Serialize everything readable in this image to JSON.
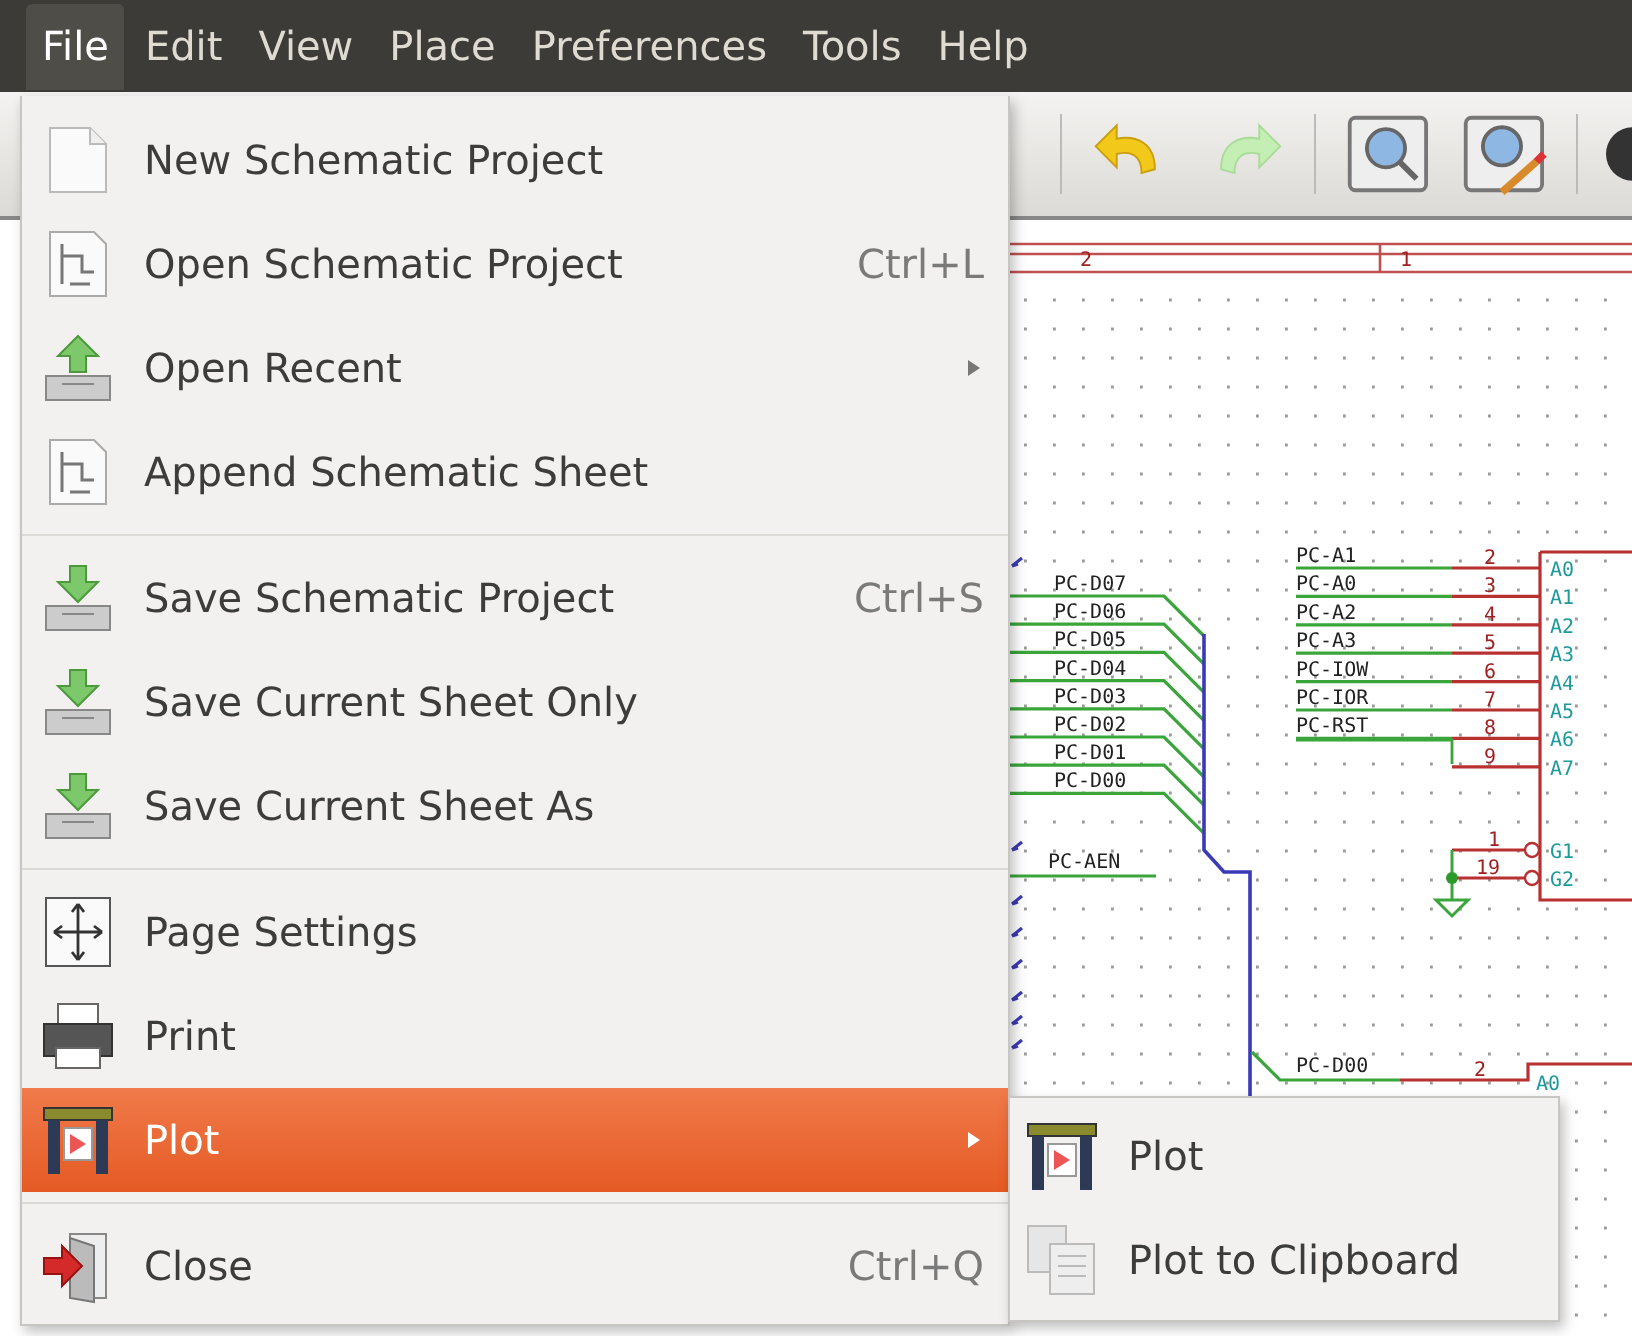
{
  "menubar": [
    {
      "label": "File",
      "selected": true
    },
    {
      "label": "Edit",
      "selected": false
    },
    {
      "label": "View",
      "selected": false
    },
    {
      "label": "Place",
      "selected": false
    },
    {
      "label": "Preferences",
      "selected": false
    },
    {
      "label": "Tools",
      "selected": false
    },
    {
      "label": "Help",
      "selected": false
    }
  ],
  "file_menu": [
    {
      "kind": "item",
      "label": "New Schematic Project",
      "submenu": false,
      "selected": false
    },
    {
      "kind": "item",
      "label": "Open Schematic Project",
      "shortcut": "Ctrl+L",
      "submenu": false,
      "selected": false
    },
    {
      "kind": "item",
      "label": "Open Recent",
      "submenu": true,
      "selected": false
    },
    {
      "kind": "item",
      "label": "Append Schematic Sheet",
      "submenu": false,
      "selected": false
    },
    {
      "kind": "separator"
    },
    {
      "kind": "item",
      "label": "Save Schematic Project",
      "shortcut": "Ctrl+S",
      "submenu": false,
      "selected": false
    },
    {
      "kind": "item",
      "label": "Save Current Sheet Only",
      "submenu": false,
      "selected": false
    },
    {
      "kind": "item",
      "label": "Save Current Sheet As",
      "submenu": false,
      "selected": false
    },
    {
      "kind": "separator"
    },
    {
      "kind": "item",
      "label": "Page Settings",
      "submenu": false,
      "selected": false
    },
    {
      "kind": "item",
      "label": "Print",
      "submenu": false,
      "selected": false
    },
    {
      "kind": "item",
      "label": "Plot",
      "submenu": true,
      "selected": true
    },
    {
      "kind": "separator"
    },
    {
      "kind": "item",
      "label": "Close",
      "shortcut": "Ctrl+Q",
      "submenu": false,
      "selected": false
    }
  ],
  "plot_submenu": [
    {
      "label": "Plot",
      "selected": false
    },
    {
      "label": "Plot to Clipboard",
      "selected": false
    }
  ],
  "schematic": {
    "frame_marks": [
      "2",
      "1"
    ],
    "bus_labels": [
      "PC-D07",
      "PC-D06",
      "PC-D05",
      "PC-D04",
      "PC-D03",
      "PC-D02",
      "PC-D01",
      "PC-D00"
    ],
    "enable_label": "PC-AEN",
    "ic_pins": [
      {
        "net": "PC-A1",
        "number": "2",
        "name": "A0"
      },
      {
        "net": "PC-A0",
        "number": "3",
        "name": "A1"
      },
      {
        "net": "PC-A2",
        "number": "4",
        "name": "A2"
      },
      {
        "net": "PC-A3",
        "number": "5",
        "name": "A3"
      },
      {
        "net": "PC-IOW",
        "number": "6",
        "name": "A4"
      },
      {
        "net": "PC-IOR",
        "number": "7",
        "name": "A5"
      },
      {
        "net": "PC-RST",
        "number": "8",
        "name": "A6"
      },
      {
        "number": "9",
        "name": "A7"
      }
    ],
    "gate_pins": [
      {
        "number": "1",
        "name": "G1"
      },
      {
        "number": "19",
        "name": "G2"
      }
    ],
    "lower_pin": {
      "net": "PC-D00",
      "number": "2",
      "name": "A0"
    }
  }
}
